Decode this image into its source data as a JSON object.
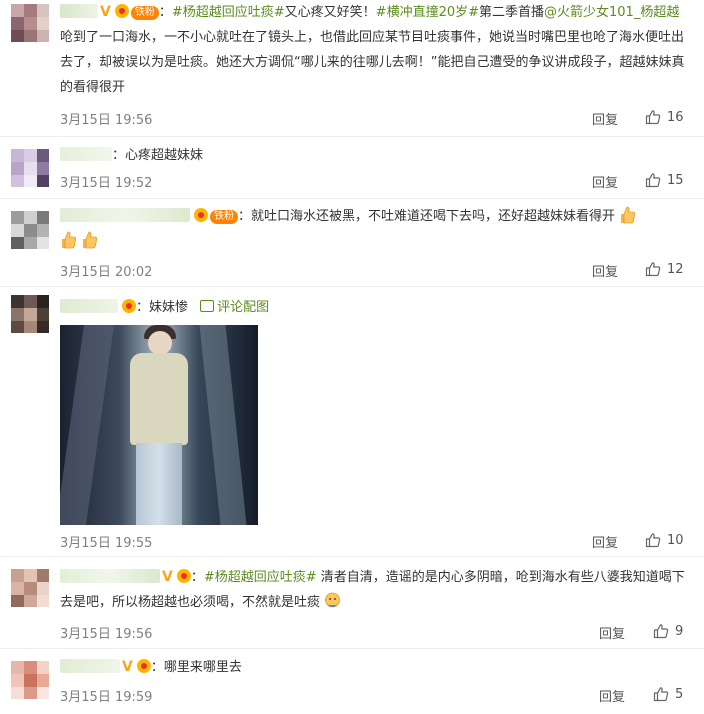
{
  "comments": [
    {
      "topic1": "#杨超越回应吐痰#",
      "text1": "又心疼又好笑！",
      "topic2": "#横冲直撞20岁#",
      "text2": "第二季首播",
      "mention": "@火箭少女101_杨超越",
      "text3": " 呛到了一口海水，一不小心就吐在了镜头上，也借此回应某节目吐痰事件，她说当时嘴巴里也呛了海水便吐出去了，却被误以为是吐痰。她还大方调侃“哪儿来的往哪儿去啊！”能把自己遭受的争议讲成段子，超越妹妹真的看得很开",
      "time": "3月15日 19:56",
      "reply": "回复",
      "likes": "16",
      "fan_badge": "铁粉"
    },
    {
      "text": "：心疼超越妹妹",
      "time": "3月15日 19:52",
      "reply": "回复",
      "likes": "15"
    },
    {
      "fan_badge": "铁粉",
      "text": "：就吐口海水还被黑，不吐难道还喝下去吗，还好超越妹妹看得开",
      "time": "3月15日 20:02",
      "reply": "回复",
      "likes": "12"
    },
    {
      "text": "：妹妹惨",
      "pic_link": "评论配图",
      "time": "3月15日 19:55",
      "reply": "回复",
      "likes": "10"
    },
    {
      "topic": "#杨超越回应吐痰#",
      "text_prefix": "：",
      "text": " 清者自清，造谣的是内心多阴暗，呛到海水有些八婆我知道喝下去是吧，所以杨超越也必须喝，不然就是吐痰",
      "time": "3月15日 19:56",
      "reply": "回复",
      "likes": "9"
    },
    {
      "text": "：哪里来哪里去",
      "time": "3月15日 19:59",
      "reply": "回复",
      "likes": "5"
    }
  ],
  "colors": {
    "link": "#5b8d1e",
    "meta": "#808080",
    "badge": "#ff8200"
  }
}
